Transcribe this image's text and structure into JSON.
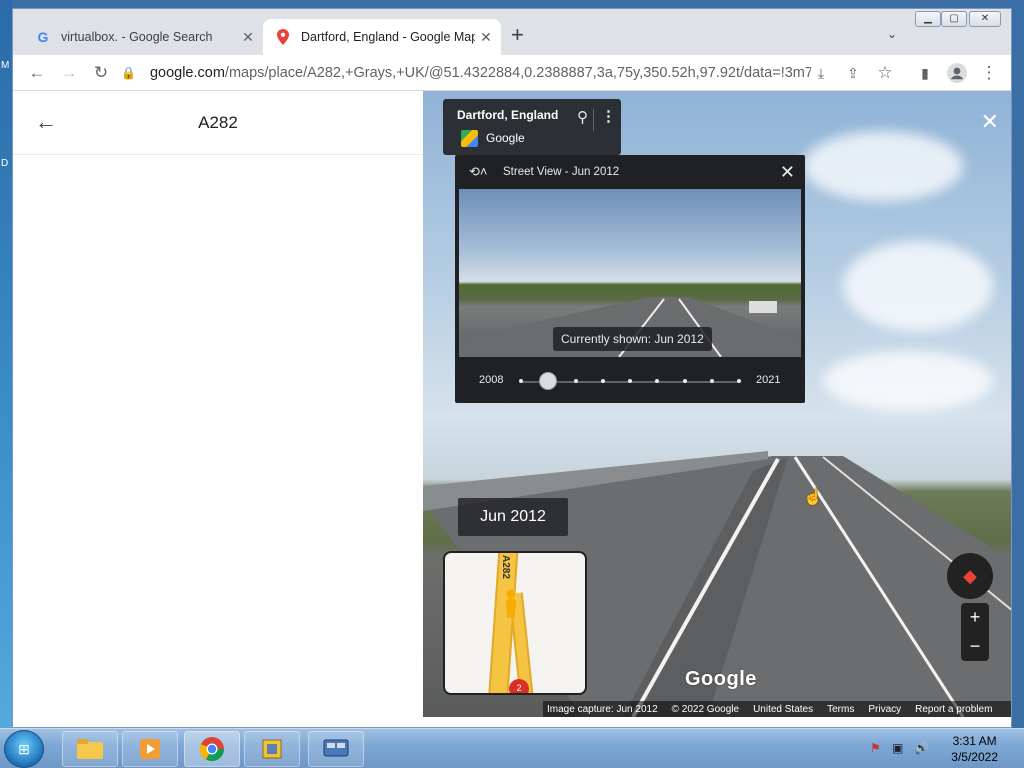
{
  "browser": {
    "tabs": [
      {
        "title": "virtualbox. - Google Search",
        "favicon": "google-g-icon",
        "active": false
      },
      {
        "title": "Dartford, England - Google Maps",
        "favicon": "maps-pin-icon",
        "active": true
      }
    ],
    "url_host": "google.com",
    "url_path": "/maps/place/A282,+Grays,+UK/@51.4322884,0.2388887,3a,75y,350.52h,97.92t/data=!3m7!..."
  },
  "panel": {
    "title": "A282"
  },
  "streetview": {
    "info_place": "Dartford, England",
    "info_attribution": "Google",
    "timemachine_label": "Street View - Jun 2012",
    "currently_shown": "Currently shown: Jun 2012",
    "year_start": "2008",
    "year_end": "2021",
    "selected_index": 1,
    "tick_count": 9,
    "date_badge": "Jun 2012",
    "minimap_road_label": "A282",
    "minimap_marker": "2",
    "google_logo": "Google",
    "footer": {
      "capture": "Image capture: Jun 2012",
      "copyright": "© 2022 Google",
      "region": "United States",
      "terms": "Terms",
      "privacy": "Privacy",
      "report": "Report a problem"
    }
  },
  "taskbar": {
    "time": "3:31 AM",
    "date": "3/5/2022"
  },
  "colors": {
    "chrome_tabbar": "#dee1e6",
    "sv_dark": "#202124",
    "accent_red": "#ea4335",
    "maps_yellow": "#f6c443"
  }
}
